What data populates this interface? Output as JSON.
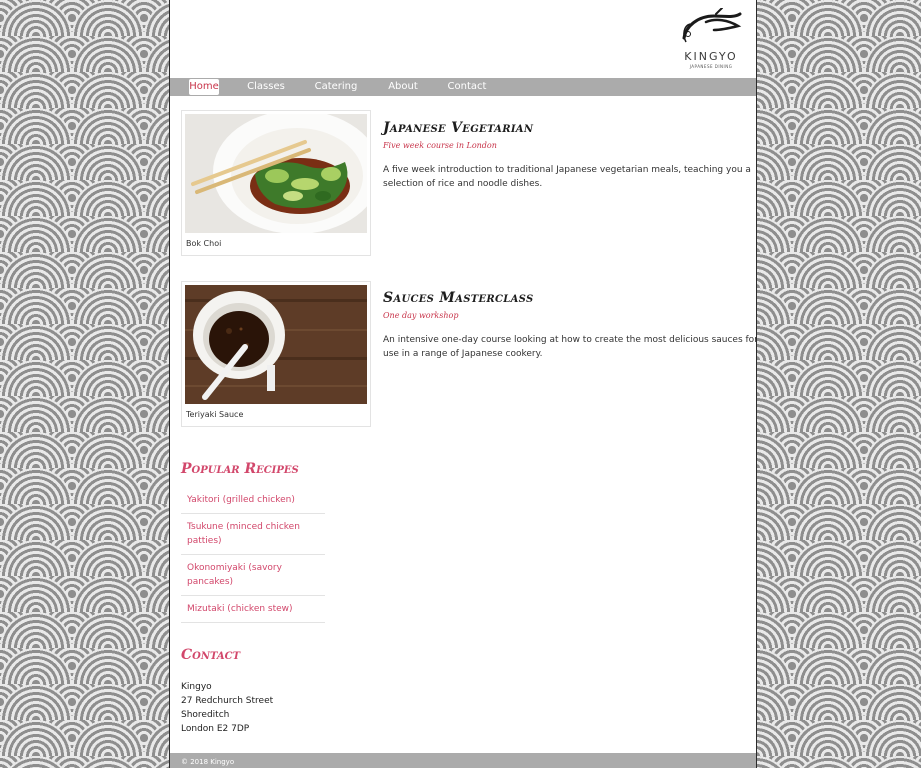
{
  "brand": {
    "name": "KINGYO",
    "tagline": "JAPANESE DINING"
  },
  "nav": {
    "items": [
      {
        "label": "Home",
        "active": true
      },
      {
        "label": "Classes",
        "active": false
      },
      {
        "label": "Catering",
        "active": false
      },
      {
        "label": "About",
        "active": false
      },
      {
        "label": "Contact",
        "active": false
      }
    ]
  },
  "courses": [
    {
      "title": "Japanese Vegetarian",
      "subtitle": "Five week course in London",
      "description": "A five week introduction to traditional Japanese vegetarian meals, teaching you a selection of rice and noodle dishes.",
      "image_caption": "Bok Choi"
    },
    {
      "title": "Sauces Masterclass",
      "subtitle": "One day workshop",
      "description": "An intensive one-day course looking at how to create the most delicious sauces for use in a range of Japanese cookery.",
      "image_caption": "Teriyaki Sauce"
    }
  ],
  "recipes": {
    "heading": "Popular Recipes",
    "items": [
      "Yakitori (grilled chicken)",
      "Tsukune (minced chicken patties)",
      "Okonomiyaki (savory pancakes)",
      "Mizutaki (chicken stew)"
    ]
  },
  "contact": {
    "heading": "Contact",
    "lines": [
      "Kingyo",
      "27 Redchurch Street",
      "Shoreditch",
      "London E2 7DP"
    ]
  },
  "footer": {
    "text": "© 2018 Kingyo"
  },
  "colors": {
    "accent": "#d2476b",
    "nav_bg": "#ababab",
    "pattern_dark": "#8e8e8e",
    "pattern_light": "#e9e9e9"
  }
}
